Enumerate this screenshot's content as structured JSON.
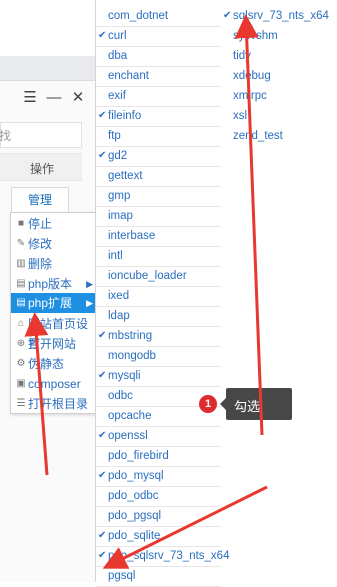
{
  "window": {
    "controls": [
      "☰",
      "—",
      "✕"
    ],
    "search_placeholder": "找",
    "op_header": "操作",
    "manage_button": "管理"
  },
  "context_menu": {
    "items": [
      {
        "label": "停止",
        "icon": "stop-icon",
        "glyph": "■"
      },
      {
        "label": "修改",
        "icon": "edit-icon",
        "glyph": "✎"
      },
      {
        "label": "删除",
        "icon": "trash-icon",
        "glyph": "▥"
      },
      {
        "label": "php版本",
        "icon": "file-icon",
        "glyph": "▤",
        "arrow": "▶"
      },
      {
        "label": "php扩展",
        "icon": "file-icon",
        "glyph": "▤",
        "arrow": "▶",
        "active": true
      },
      {
        "label": "网站首页设置",
        "icon": "home-icon",
        "glyph": "⌂"
      },
      {
        "label": "打开网站",
        "icon": "globe-icon",
        "glyph": "⊕"
      },
      {
        "label": "伪静态",
        "icon": "settings-icon",
        "glyph": "⚙"
      },
      {
        "label": "composer",
        "icon": "package-icon",
        "glyph": "▣"
      },
      {
        "label": "打开根目录",
        "icon": "list-icon",
        "glyph": "☰"
      }
    ]
  },
  "extensions": {
    "check_glyph": "✔",
    "col1": [
      {
        "label": "com_dotnet",
        "checked": false
      },
      {
        "label": "curl",
        "checked": true
      },
      {
        "label": "dba",
        "checked": false
      },
      {
        "label": "enchant",
        "checked": false
      },
      {
        "label": "exif",
        "checked": false
      },
      {
        "label": "fileinfo",
        "checked": true
      },
      {
        "label": "ftp",
        "checked": false
      },
      {
        "label": "gd2",
        "checked": true
      },
      {
        "label": "gettext",
        "checked": false
      },
      {
        "label": "gmp",
        "checked": false
      },
      {
        "label": "imap",
        "checked": false
      },
      {
        "label": "interbase",
        "checked": false
      },
      {
        "label": "intl",
        "checked": false
      },
      {
        "label": "ioncube_loader",
        "checked": false
      },
      {
        "label": "ixed",
        "checked": false
      },
      {
        "label": "ldap",
        "checked": false
      },
      {
        "label": "mbstring",
        "checked": true
      },
      {
        "label": "mongodb",
        "checked": false
      },
      {
        "label": "mysqli",
        "checked": true
      },
      {
        "label": "odbc",
        "checked": false
      },
      {
        "label": "opcache",
        "checked": false
      },
      {
        "label": "openssl",
        "checked": true
      },
      {
        "label": "pdo_firebird",
        "checked": false
      },
      {
        "label": "pdo_mysql",
        "checked": true
      },
      {
        "label": "pdo_odbc",
        "checked": false
      },
      {
        "label": "pdo_pgsql",
        "checked": false
      },
      {
        "label": "pdo_sqlite",
        "checked": true
      },
      {
        "label": "pdo_sqlsrv_73_nts_x64",
        "checked": true
      },
      {
        "label": "pgsql",
        "checked": false
      }
    ],
    "col2": [
      {
        "label": "sqlsrv_73_nts_x64",
        "checked": true
      },
      {
        "label": "sysvshm",
        "checked": false
      },
      {
        "label": "tidy",
        "checked": false
      },
      {
        "label": "xdebug",
        "checked": false
      },
      {
        "label": "xmlrpc",
        "checked": false
      },
      {
        "label": "xsl",
        "checked": false
      },
      {
        "label": "zend_test",
        "checked": false
      }
    ]
  },
  "annotation": {
    "number": "1",
    "text": "勾选",
    "badge_color": "#e02b2b",
    "arrow_color": "#e8382f"
  }
}
